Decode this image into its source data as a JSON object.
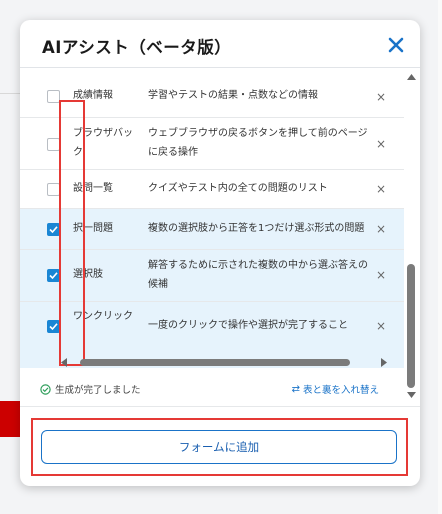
{
  "dialog": {
    "title": "AIアシスト（ベータ版）"
  },
  "terms": [
    {
      "term": "成績情報",
      "description": "学習やテストの結果・点数などの情報",
      "checked": false
    },
    {
      "term": "ブラウザバック",
      "description": "ウェブブラウザの戻るボタンを押して前のページに戻る操作",
      "checked": false
    },
    {
      "term": "設問一覧",
      "description": "クイズやテスト内の全ての問題のリスト",
      "checked": false
    },
    {
      "term": "択一問題",
      "description": "複数の選択肢から正答を1つだけ選ぶ形式の問題",
      "checked": true
    },
    {
      "term": "選択肢",
      "description": "解答するために示された複数の中から選ぶ答えの候補",
      "checked": true
    },
    {
      "term": "ワンクリック",
      "description": "一度のクリックで操作や選択が完了すること",
      "checked": true
    }
  ],
  "delete_glyph": "×",
  "status": {
    "text": "生成が完了しました"
  },
  "swap_link": "表と裏を入れ替え",
  "add_button": "フォームに追加",
  "colors": {
    "accent": "#1a86d4",
    "highlight": "#e53935",
    "selected_row": "#e6f3fc"
  }
}
